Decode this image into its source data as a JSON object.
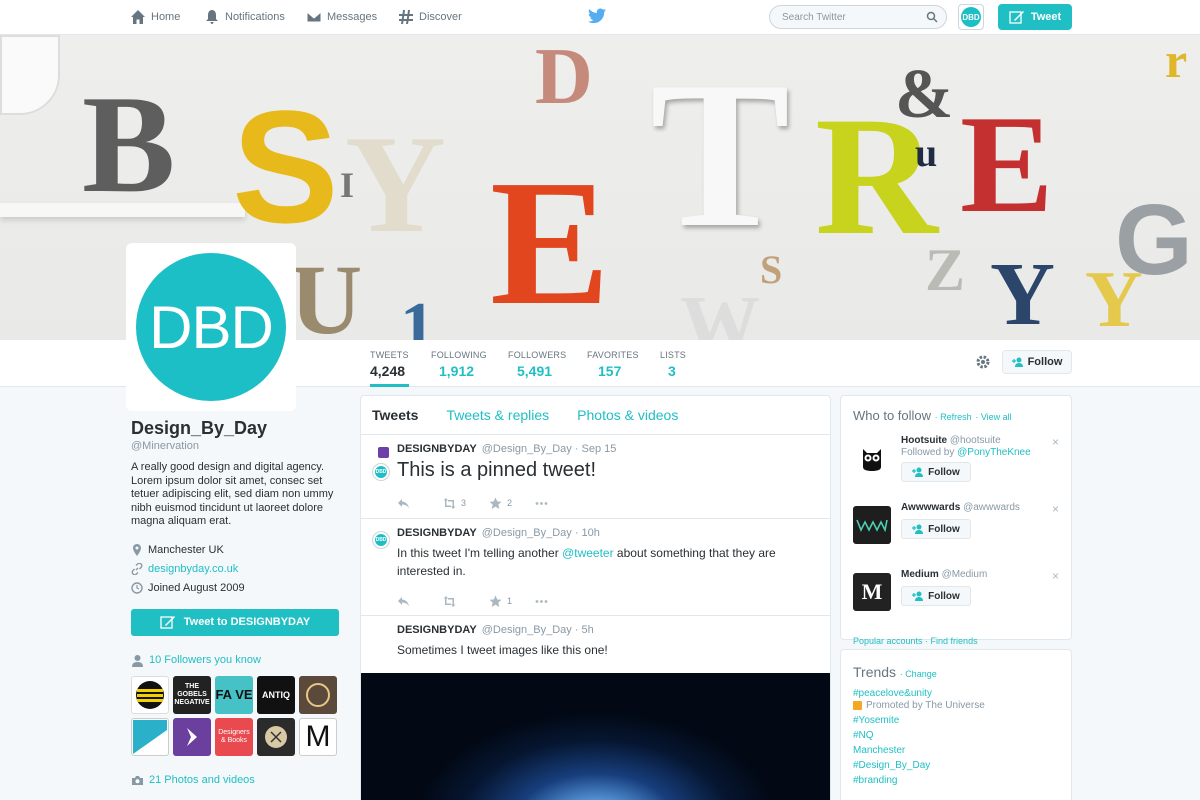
{
  "nav": {
    "home": "Home",
    "notifications": "Notifications",
    "messages": "Messages",
    "discover": "Discover",
    "search_placeholder": "Search Twitter",
    "avatar_text": "DBD",
    "tweet_button": "Tweet"
  },
  "profile": {
    "avatar_text": "DBD",
    "name": "Design_By_Day",
    "handle": "@Minervation",
    "bio": "A really good design and digital agency. Lorem ipsum dolor sit amet, consec set tetuer adipiscing elit, sed diam non ummy nibh euismod tincidunt ut laoreet dolore magna aliquam erat.",
    "location": "Manchester UK",
    "website": "designbyday.co.uk",
    "joined": "Joined August 2009",
    "tweet_to": "Tweet to DESIGNBYDAY",
    "followers_you_know": "10 Followers you know",
    "photos_videos": "21 Photos and videos",
    "follower_tiles": [
      {
        "label": "",
        "color": "#f5d000"
      },
      {
        "label": "THE GOBELS NEGATIVE",
        "color": "#222222"
      },
      {
        "label": "FA VE",
        "color": "#46c2c7"
      },
      {
        "label": "ANTIQ",
        "color": "#111111"
      },
      {
        "label": "",
        "color": "#5b4a3c"
      },
      {
        "label": "",
        "color": "#2ab0c9"
      },
      {
        "label": "",
        "color": "#6a3f9e"
      },
      {
        "label": "Designers & Books",
        "color": "#e94a4f"
      },
      {
        "label": "",
        "color": "#2b2b2b"
      },
      {
        "label": "M",
        "color": "#111111"
      }
    ]
  },
  "stats": [
    {
      "label": "TWEETS",
      "value": "4,248"
    },
    {
      "label": "FOLLOWING",
      "value": "1,912"
    },
    {
      "label": "FOLLOWERS",
      "value": "5,491"
    },
    {
      "label": "FAVORITES",
      "value": "157"
    },
    {
      "label": "LISTS",
      "value": "3"
    }
  ],
  "follow_button": "Follow",
  "timeline": {
    "tabs": [
      "Tweets",
      "Tweets & replies",
      "Photos & videos"
    ],
    "tweets": [
      {
        "name": "DESIGNBYDAY",
        "meta": "@Design_By_Day · Sep 15",
        "text": "This is a pinned tweet!",
        "retweets": "3",
        "favorites": "2"
      },
      {
        "name": "DESIGNBYDAY",
        "meta": "@Design_By_Day · 10h",
        "text_before": "In this tweet I'm telling another ",
        "mention": "@tweeter",
        "text_after": " about something that they are interested in.",
        "retweets": "",
        "favorites": "1"
      },
      {
        "name": "DESIGNBYDAY",
        "meta": "@Design_By_Day · 5h",
        "text": "Sometimes I tweet images like this one!"
      }
    ]
  },
  "who_to_follow": {
    "title": "Who to follow",
    "refresh": "Refresh",
    "view_all": "View all",
    "suggestions": [
      {
        "name": "Hootsuite",
        "handle": "@hootsuite",
        "followed_by_prefix": "Followed by ",
        "followed_by": "@PonyTheKnee",
        "button": "Follow",
        "color": "#ffffff",
        "mark": "🦉"
      },
      {
        "name": "Awwwwards",
        "handle": "@awwwards",
        "button": "Follow",
        "color": "#1e1e1e",
        "mark": "W"
      },
      {
        "name": "Medium",
        "handle": "@Medium",
        "button": "Follow",
        "color": "#222222",
        "mark": "M"
      }
    ],
    "popular": "Popular accounts",
    "find_friends": "Find friends"
  },
  "trends": {
    "title": "Trends",
    "change": "Change",
    "items": [
      "#peacelove&unity",
      "#Yosemite",
      "#NQ",
      "Manchester",
      "#Design_By_Day",
      "#branding"
    ],
    "promoted": "Promoted by The Universe"
  }
}
